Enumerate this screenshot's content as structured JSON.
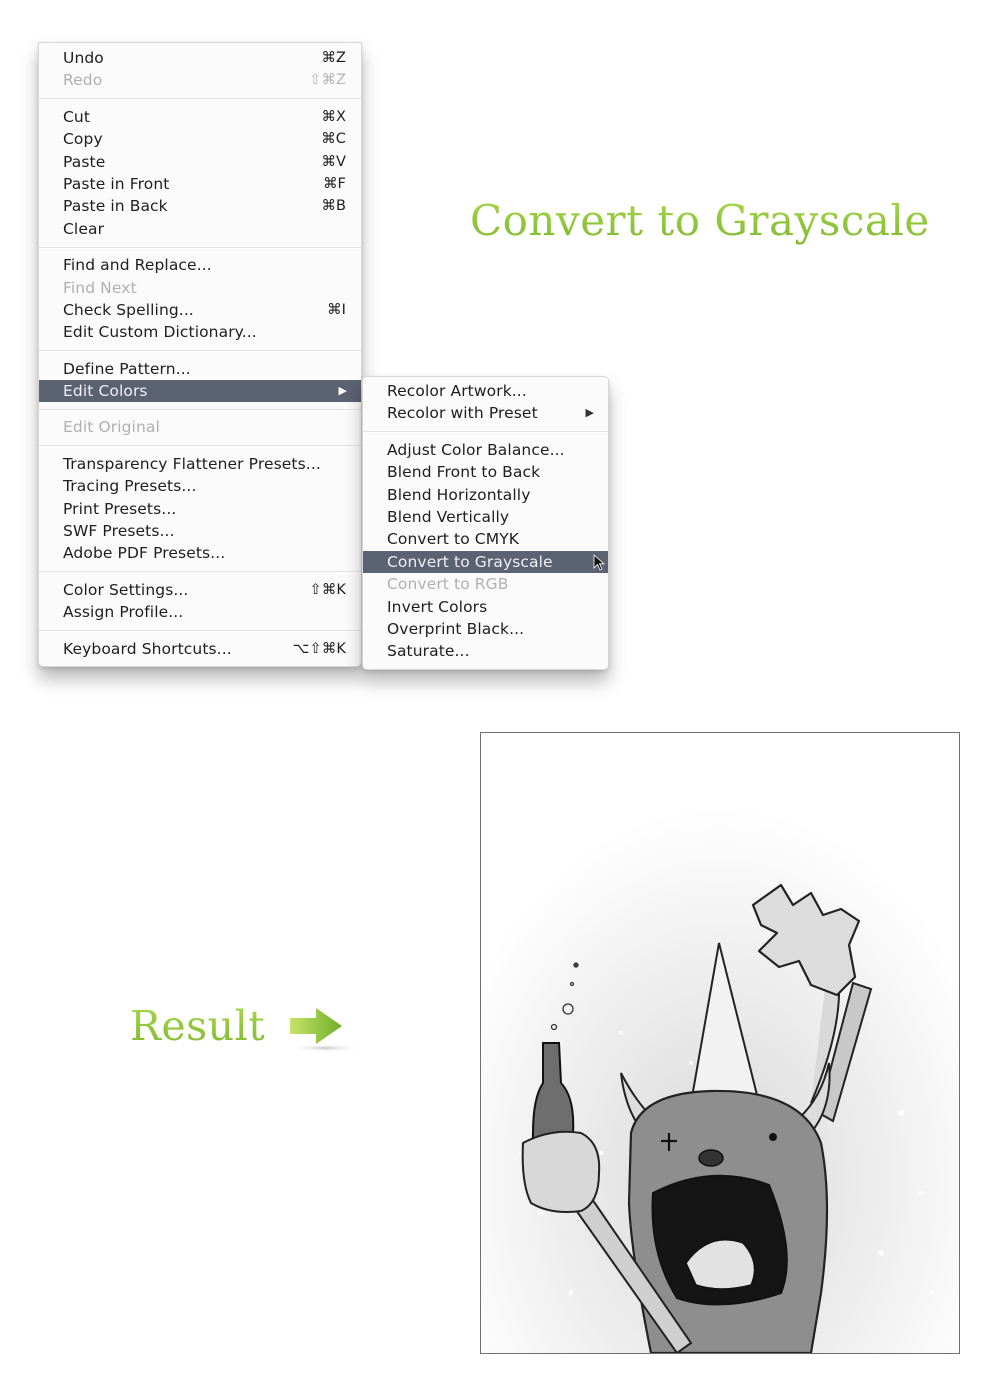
{
  "edit_menu": {
    "groups": [
      [
        {
          "label": "Undo",
          "shortcut": "⌘Z",
          "enabled": true
        },
        {
          "label": "Redo",
          "shortcut": "⇧⌘Z",
          "enabled": false
        }
      ],
      [
        {
          "label": "Cut",
          "shortcut": "⌘X",
          "enabled": true
        },
        {
          "label": "Copy",
          "shortcut": "⌘C",
          "enabled": true
        },
        {
          "label": "Paste",
          "shortcut": "⌘V",
          "enabled": true
        },
        {
          "label": "Paste in Front",
          "shortcut": "⌘F",
          "enabled": true
        },
        {
          "label": "Paste in Back",
          "shortcut": "⌘B",
          "enabled": true
        },
        {
          "label": "Clear",
          "shortcut": "",
          "enabled": true
        }
      ],
      [
        {
          "label": "Find and Replace...",
          "shortcut": "",
          "enabled": true
        },
        {
          "label": "Find Next",
          "shortcut": "",
          "enabled": false
        },
        {
          "label": "Check Spelling...",
          "shortcut": "⌘I",
          "enabled": true
        },
        {
          "label": "Edit Custom Dictionary...",
          "shortcut": "",
          "enabled": true
        }
      ],
      [
        {
          "label": "Define Pattern...",
          "shortcut": "",
          "enabled": true
        },
        {
          "label": "Edit Colors",
          "shortcut": "",
          "enabled": true,
          "submenu": true,
          "selected": true
        }
      ],
      [
        {
          "label": "Edit Original",
          "shortcut": "",
          "enabled": false
        }
      ],
      [
        {
          "label": "Transparency Flattener Presets...",
          "shortcut": "",
          "enabled": true
        },
        {
          "label": "Tracing Presets...",
          "shortcut": "",
          "enabled": true
        },
        {
          "label": "Print Presets...",
          "shortcut": "",
          "enabled": true
        },
        {
          "label": "SWF Presets...",
          "shortcut": "",
          "enabled": true
        },
        {
          "label": "Adobe PDF Presets...",
          "shortcut": "",
          "enabled": true
        }
      ],
      [
        {
          "label": "Color Settings...",
          "shortcut": "⇧⌘K",
          "enabled": true
        },
        {
          "label": "Assign Profile...",
          "shortcut": "",
          "enabled": true
        }
      ],
      [
        {
          "label": "Keyboard Shortcuts...",
          "shortcut": "⌥⇧⌘K",
          "enabled": true
        }
      ]
    ]
  },
  "edit_colors_submenu": {
    "groups": [
      [
        {
          "label": "Recolor Artwork...",
          "enabled": true
        },
        {
          "label": "Recolor with Preset",
          "enabled": true,
          "submenu": true
        }
      ],
      [
        {
          "label": "Adjust Color Balance...",
          "enabled": true
        },
        {
          "label": "Blend Front to Back",
          "enabled": true
        },
        {
          "label": "Blend Horizontally",
          "enabled": true
        },
        {
          "label": "Blend Vertically",
          "enabled": true
        },
        {
          "label": "Convert to CMYK",
          "enabled": true
        },
        {
          "label": "Convert to Grayscale",
          "enabled": true,
          "selected": true
        },
        {
          "label": "Convert to RGB",
          "enabled": false
        },
        {
          "label": "Invert Colors",
          "enabled": true
        },
        {
          "label": "Overprint Black...",
          "enabled": true
        },
        {
          "label": "Saturate...",
          "enabled": true
        }
      ]
    ]
  },
  "icons": {
    "submenu_arrow": "▶",
    "pointer": "mouse-pointer-icon",
    "result_arrow": "right-arrow-icon"
  },
  "callouts": {
    "title": "Convert to Grayscale",
    "result_label": "Result"
  },
  "colors": {
    "accent_green": "#8cc63f",
    "menu_highlight": "#5b6271",
    "disabled_text": "#b0b0b0"
  },
  "artwork": {
    "description": "Grayscale illustration of a furry horned monster wearing a party hat, holding a bottle and raising a clawed hand"
  }
}
